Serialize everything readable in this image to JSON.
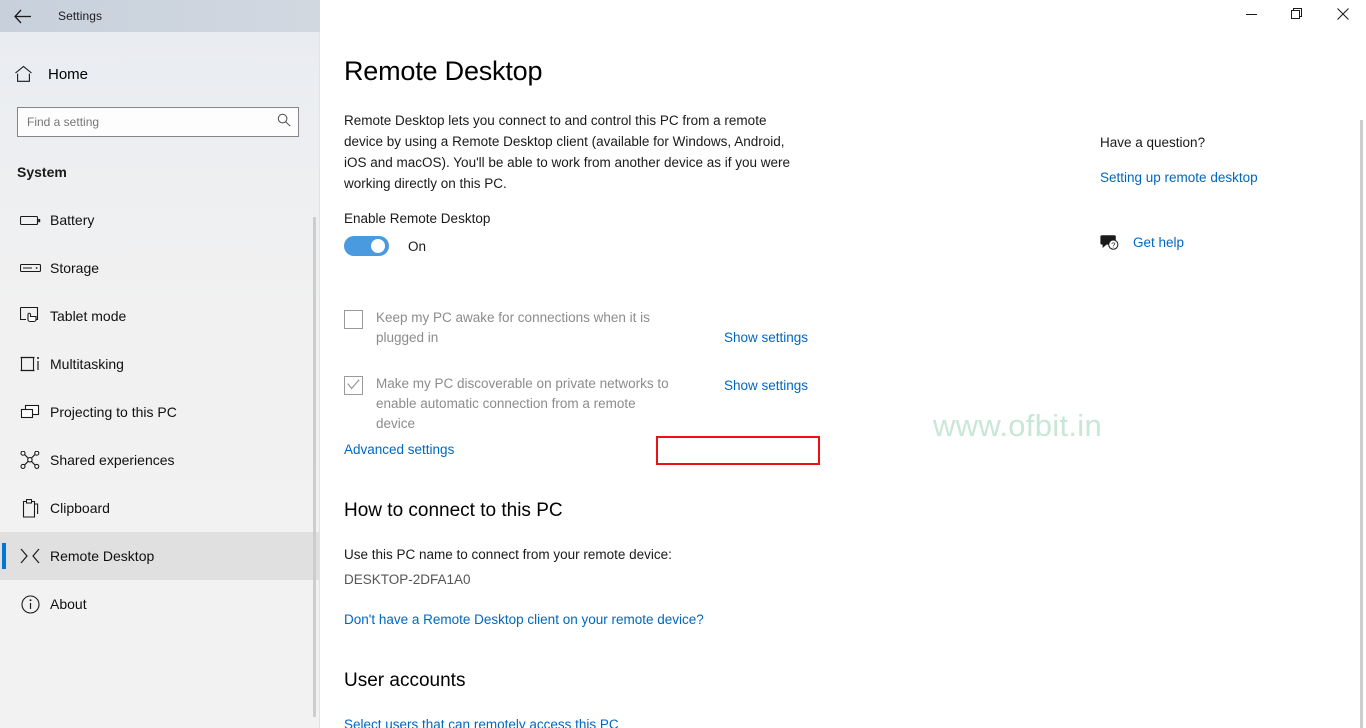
{
  "window": {
    "title": "Settings",
    "back_icon": "back-arrow-icon",
    "minimize_label": "—",
    "maximize_label": "❐",
    "close_label": "✕"
  },
  "sidebar": {
    "home_label": "Home",
    "home_icon": "home-icon",
    "search": {
      "placeholder": "Find a setting",
      "value": "",
      "icon": "search-icon"
    },
    "section_label": "System",
    "items": [
      {
        "label": "Battery",
        "icon": "battery-icon",
        "selected": false
      },
      {
        "label": "Storage",
        "icon": "storage-drive-icon",
        "selected": false
      },
      {
        "label": "Tablet mode",
        "icon": "tablet-touch-icon",
        "selected": false
      },
      {
        "label": "Multitasking",
        "icon": "multitasking-icon",
        "selected": false
      },
      {
        "label": "Projecting to this PC",
        "icon": "projecting-icon",
        "selected": false
      },
      {
        "label": "Shared experiences",
        "icon": "shared-experiences-icon",
        "selected": false
      },
      {
        "label": "Clipboard",
        "icon": "clipboard-icon",
        "selected": false
      },
      {
        "label": "Remote Desktop",
        "icon": "remote-desktop-icon",
        "selected": true
      },
      {
        "label": "About",
        "icon": "info-circle-icon",
        "selected": false
      }
    ]
  },
  "main": {
    "page_title": "Remote Desktop",
    "description": "Remote Desktop lets you connect to and control this PC from a remote device by using a Remote Desktop client (available for Windows, Android, iOS and macOS). You'll be able to work from another device as if you were working directly on this PC.",
    "enable_label": "Enable Remote Desktop",
    "toggle": {
      "state_label": "On",
      "checked": true,
      "on_color": "#4a9ae0"
    },
    "options": [
      {
        "label": "Keep my PC awake for connections when it is plugged in",
        "checked": false,
        "link_label": "Show settings"
      },
      {
        "label": "Make my PC discoverable on private networks to enable automatic connection from a remote device",
        "checked": true,
        "link_label": "Show settings"
      }
    ],
    "advanced_settings_label": "Advanced settings",
    "connect_section": {
      "heading": "How to connect to this PC",
      "instruction": "Use this PC name to connect from your remote device:",
      "pc_name": "DESKTOP-2DFA1A0",
      "client_link": "Don't have a Remote Desktop client on your remote device?"
    },
    "user_accounts_section": {
      "heading": "User accounts",
      "select_users_link": "Select users that can remotely access this PC"
    }
  },
  "right_panel": {
    "title": "Have a question?",
    "help_link": "Setting up remote desktop",
    "get_help_label": "Get help",
    "get_help_icon": "help-bubble-icon"
  },
  "annotation": {
    "highlight_color": "#ee1111",
    "target": "Advanced settings"
  },
  "watermark": {
    "text": "www.ofbit.in",
    "color": "#c9e7d7"
  }
}
